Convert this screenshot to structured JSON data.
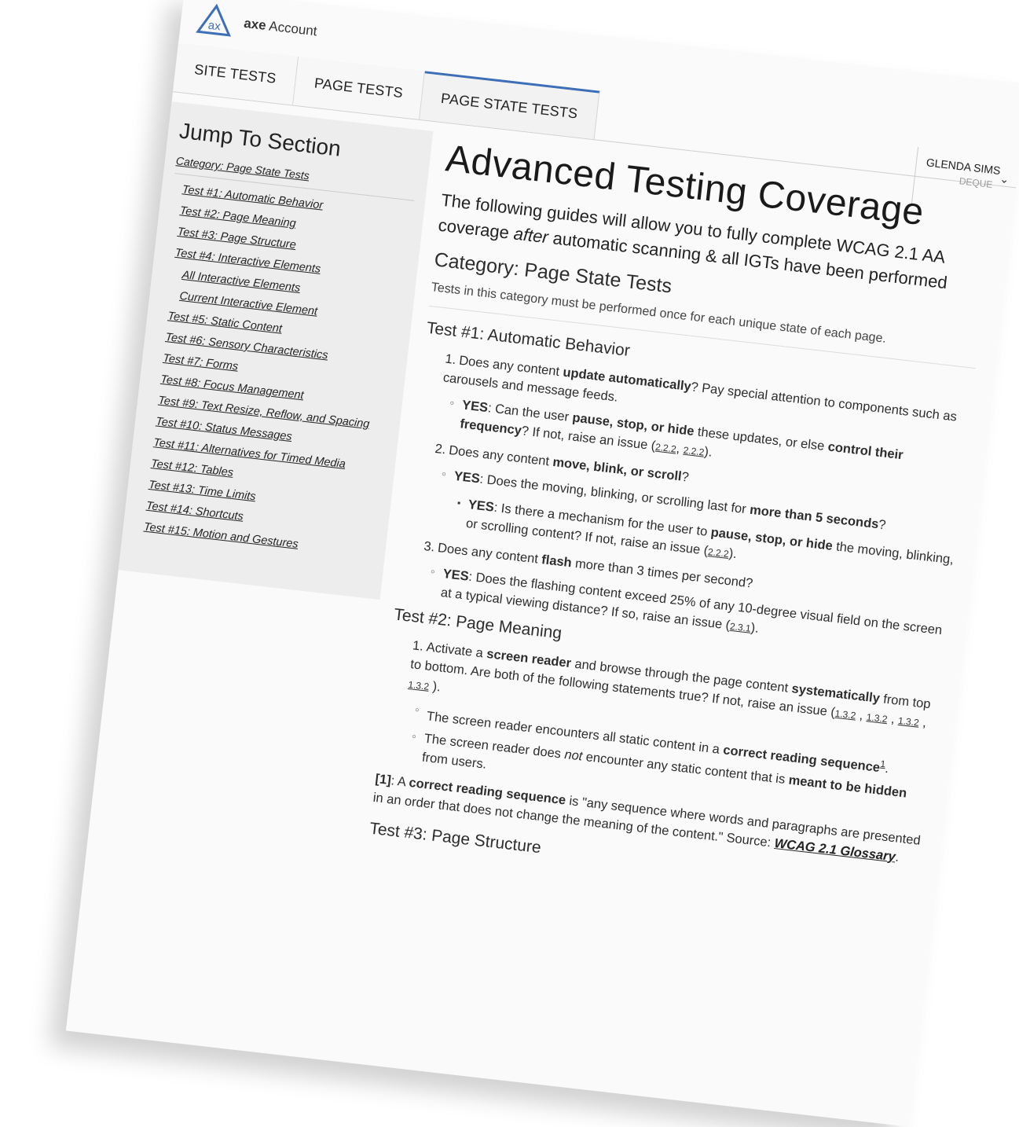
{
  "header": {
    "brand_bold": "axe",
    "brand_rest": "Account",
    "tabs": [
      "SITE TESTS",
      "PAGE TESTS",
      "PAGE STATE TESTS"
    ],
    "user_name": "GLENDA SIMS",
    "user_org": "DEQUE"
  },
  "sidebar": {
    "title": "Jump To Section",
    "category": "Category: Page State Tests",
    "items": [
      "Test #1: Automatic Behavior",
      "Test #2: Page Meaning",
      "Test #3: Page Structure",
      "Test #4: Interactive Elements",
      "All Interactive Elements",
      "Current Interactive Element",
      "Test #5: Static Content",
      "Test #6: Sensory Characteristics",
      "Test #7: Forms",
      "Test #8: Focus Management",
      "Test #9: Text Resize, Reflow, and Spacing",
      "Test #10: Status Messages",
      "Test #11: Alternatives for Timed Media",
      "Test #12: Tables",
      "Test #13: Time Limits",
      "Test #14: Shortcuts",
      "Test #15: Motion and Gestures"
    ]
  },
  "main": {
    "title": "Advanced Testing Coverage",
    "lead_1": "The following guides will allow you to fully complete WCAG 2.1 AA coverage ",
    "lead_em": "after",
    "lead_2": " automatic scanning & all IGTs have been performed",
    "category_title": "Category: Page State Tests",
    "category_desc": "Tests in this category must be performed once for each unique state of each page.",
    "test1": {
      "title": "Test #1: Automatic Behavior",
      "q1_a": "Does any content ",
      "q1_b": "update automatically",
      "q1_c": "? Pay special attention to components such as carousels and message feeds.",
      "q1_yes": "YES",
      "q1_o_a": ": Can the user ",
      "q1_o_b": "pause, stop, or hide",
      "q1_o_c": " these updates, or else ",
      "q1_o_d": "control their frequency",
      "q1_o_e": "? If not, raise an issue (",
      "q1_ref1": "2.2.2",
      "q1_ref2": "2.2.2",
      "q2_a": "Does any content ",
      "q2_b": "move, blink, or scroll",
      "q2_c": "?",
      "q2_yes": "YES",
      "q2_o_a": ": Does the moving, blinking, or scrolling last for ",
      "q2_o_b": "more than 5 seconds",
      "q2_o_c": "?",
      "q2_yes2": "YES",
      "q2_s_a": ": Is there a mechanism for the user to ",
      "q2_s_b": "pause, stop, or hide",
      "q2_s_c": " the moving, blinking, or scrolling content? If not, raise an issue (",
      "q2_ref": "2.2.2",
      "q3_a": "Does any content ",
      "q3_b": "flash",
      "q3_c": " more than 3 times per second?",
      "q3_yes": "YES",
      "q3_o_a": ": Does the flashing content exceed 25% of any 10-degree visual field on the screen at a typical viewing distance? If so, raise an issue (",
      "q3_ref": "2.3.1"
    },
    "test2": {
      "title": "Test #2: Page Meaning",
      "q1_a": "Activate a ",
      "q1_b": "screen reader",
      "q1_c": " and browse through the page content ",
      "q1_d": "systematically",
      "q1_e": " from top to bottom. Are both of the following statements true? If not, raise an issue (",
      "refs": [
        "1.3.2",
        "1.3.2",
        "1.3.2",
        "1.3.2"
      ],
      "o1_a": "The screen reader encounters all static content in a ",
      "o1_b": "correct reading sequence",
      "o1_sup": "1",
      "o2_a": "The screen reader does ",
      "o2_b": "not",
      "o2_c": " encounter any static content that is ",
      "o2_d": "meant to be hidden",
      "o2_e": " from users.",
      "fn_label": "[1]",
      "fn_a": ": A ",
      "fn_b": "correct reading sequence",
      "fn_c": " is \"any sequence where words and paragraphs are presented in an order that does not change the meaning of the content.\" Source: ",
      "fn_link": "WCAG 2.1 Glossary"
    },
    "test3_title": "Test #3: Page Structure"
  },
  "colors": {
    "accent": "#3c6fb7",
    "sidebar_bg": "#ededed"
  }
}
